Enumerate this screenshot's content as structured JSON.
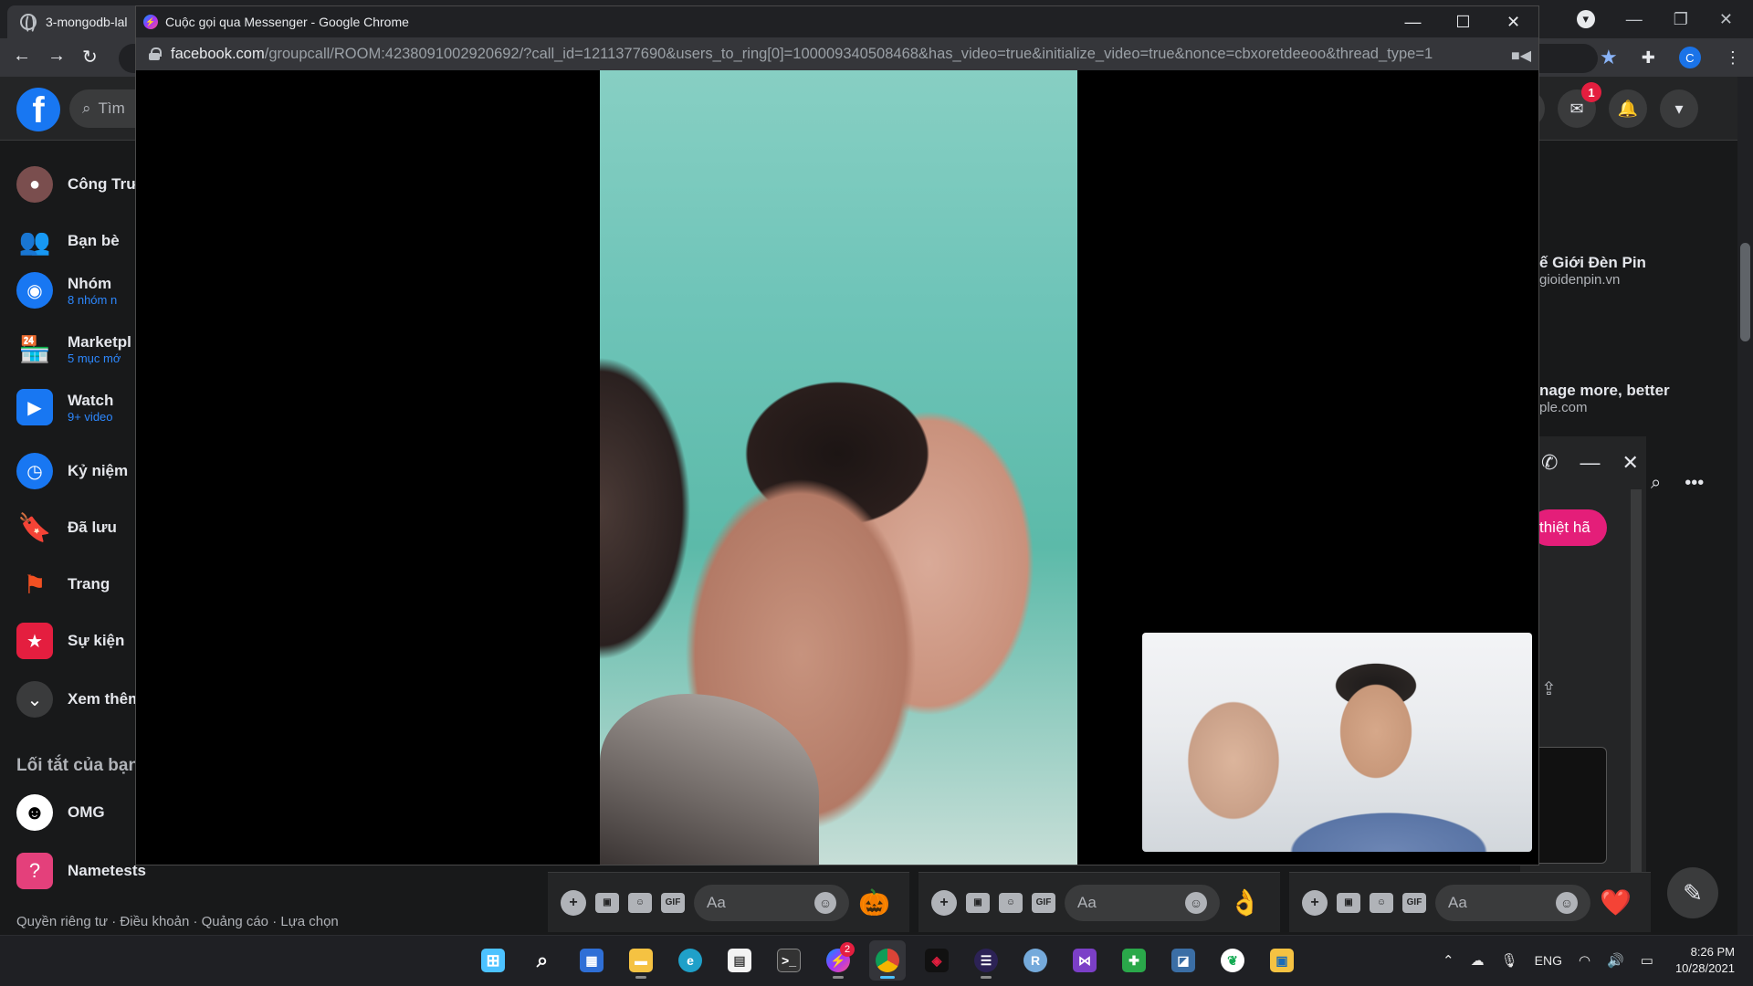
{
  "background_browser": {
    "tab_title": "3-mongodb-lal"
  },
  "facebook": {
    "search_placeholder": "Tìm",
    "messenger_badge": "1",
    "sidebar": [
      {
        "label": "Công Trư",
        "sub": "",
        "icon": "profile-avatar",
        "color": "#7a4e4e"
      },
      {
        "label": "Bạn bè",
        "sub": "",
        "icon": "friends-icon",
        "color": "#1877f2"
      },
      {
        "label": "Nhóm",
        "sub": "8 nhóm n",
        "icon": "groups-icon",
        "color": "#1877f2"
      },
      {
        "label": "Marketpl",
        "sub": "5 mục mớ",
        "icon": "marketplace-icon",
        "color": "#1877f2"
      },
      {
        "label": "Watch",
        "sub": "9+ video",
        "icon": "watch-icon",
        "color": "#1877f2"
      },
      {
        "label": "Kỷ niệm",
        "sub": "",
        "icon": "memories-icon",
        "color": "#1877f2"
      },
      {
        "label": "Đã lưu",
        "sub": "",
        "icon": "saved-icon",
        "color": "#a033ff"
      },
      {
        "label": "Trang",
        "sub": "",
        "icon": "pages-icon",
        "color": "#f25022"
      },
      {
        "label": "Sự kiện",
        "sub": "",
        "icon": "events-icon",
        "color": "#e41e3f"
      },
      {
        "label": "Xem thêm",
        "sub": "",
        "icon": "chevron-down-icon",
        "color": "#3a3b3c"
      }
    ],
    "shortcuts_title": "Lối tắt của bạn",
    "shortcuts": [
      {
        "label": "OMG",
        "icon": "omg-icon"
      },
      {
        "label": "Nametests",
        "icon": "nametests-icon"
      }
    ],
    "footer": "Quyền riêng tư · Điều khoản · Quảng cáo · Lựa chọn",
    "ads": [
      {
        "title": "ế Giới Đèn Pin",
        "url": "gioidenpin.vn"
      },
      {
        "title": "nage more, better",
        "url": "ple.com"
      }
    ],
    "chat_pill_text": "thiệt hã",
    "chat_input_placeholder": "Aa",
    "chat_bars": [
      {
        "react": "🎃"
      },
      {
        "react": "👌"
      },
      {
        "react": "❤️"
      }
    ]
  },
  "popup": {
    "window_title": "Cuộc gọi qua Messenger - Google Chrome",
    "url_domain": "facebook.com",
    "url_rest": "/groupcall/ROOM:4238091002920692/?call_id=1211377690&users_to_ring[0]=100009340508468&has_video=true&initialize_video=true&nonce=cbxoretdeeoo&thread_type=1"
  },
  "taskbar": {
    "messenger_badge": "2",
    "language": "ENG",
    "time": "8:26 PM",
    "date": "10/28/2021"
  }
}
